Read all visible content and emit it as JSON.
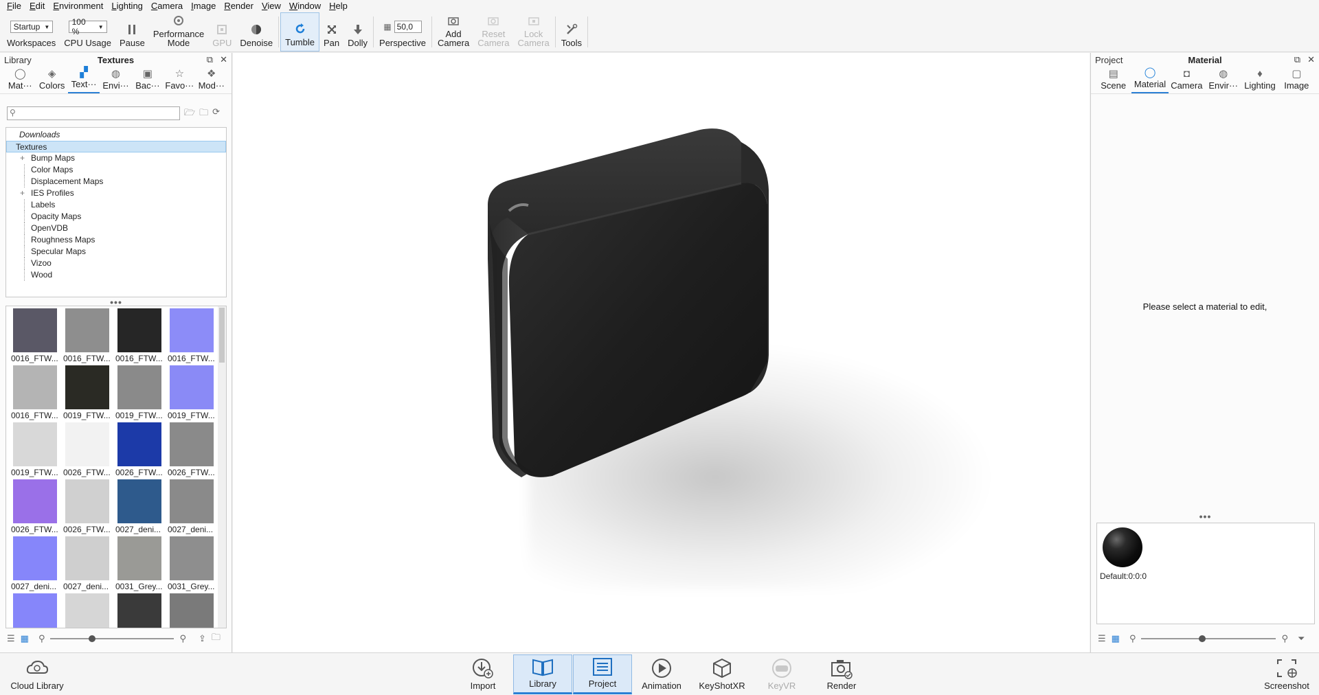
{
  "menu": [
    "File",
    "Edit",
    "Environment",
    "Lighting",
    "Camera",
    "Image",
    "Render",
    "View",
    "Window",
    "Help"
  ],
  "toolbar": {
    "workspace_value": "Startup",
    "workspaces_label": "Workspaces",
    "cpu_value": "100 %",
    "cpu_label": "CPU Usage",
    "pause_label": "Pause",
    "performance_label_1": "Performance",
    "performance_label_2": "Mode",
    "gpu_label": "GPU",
    "denoise_label": "Denoise",
    "tumble_label": "Tumble",
    "pan_label": "Pan",
    "dolly_label": "Dolly",
    "perspective_value": "50,0",
    "perspective_label": "Perspective",
    "add_camera_1": "Add",
    "add_camera_2": "Camera",
    "reset_camera_1": "Reset",
    "reset_camera_2": "Camera",
    "lock_camera_1": "Lock",
    "lock_camera_2": "Camera",
    "tools_label": "Tools"
  },
  "library": {
    "section": "Library",
    "title": "Textures",
    "tabs": [
      {
        "label": "Mat···",
        "icon": "material-icon"
      },
      {
        "label": "Colors",
        "icon": "colors-icon"
      },
      {
        "label": "Text···",
        "icon": "textures-icon",
        "selected": true
      },
      {
        "label": "Envi···",
        "icon": "environment-icon"
      },
      {
        "label": "Bac···",
        "icon": "backplates-icon"
      },
      {
        "label": "Favo···",
        "icon": "favorites-icon"
      },
      {
        "label": "Mod···",
        "icon": "models-icon"
      }
    ],
    "search_placeholder": "",
    "tree": {
      "downloads": "Downloads",
      "textures": "Textures",
      "children": [
        "Bump Maps",
        "Color Maps",
        "Displacement Maps",
        "IES Profiles",
        "Labels",
        "Opacity Maps",
        "OpenVDB",
        "Roughness Maps",
        "Specular Maps",
        "Vizoo",
        "Wood"
      ]
    },
    "thumbnails": [
      {
        "caption": "0016_FTW...",
        "color": "#5a5866"
      },
      {
        "caption": "0016_FTW...",
        "color": "#8e8e8e"
      },
      {
        "caption": "0016_FTW...",
        "color": "#262626"
      },
      {
        "caption": "0016_FTW...",
        "color": "#8c8cf8"
      },
      {
        "caption": "0016_FTW...",
        "color": "#b4b4b4"
      },
      {
        "caption": "0019_FTW...",
        "color": "#2a2a24"
      },
      {
        "caption": "0019_FTW...",
        "color": "#8a8a8a"
      },
      {
        "caption": "0019_FTW...",
        "color": "#8a8af6"
      },
      {
        "caption": "0019_FTW...",
        "color": "#d8d8d8"
      },
      {
        "caption": "0026_FTW...",
        "color": "#f2f2f2"
      },
      {
        "caption": "0026_FTW...",
        "color": "#1c3aa8"
      },
      {
        "caption": "0026_FTW...",
        "color": "#8a8a8a"
      },
      {
        "caption": "0026_FTW...",
        "color": "#9a70e8"
      },
      {
        "caption": "0026_FTW...",
        "color": "#d0d0d0"
      },
      {
        "caption": "0027_deni...",
        "color": "#2e5a8c"
      },
      {
        "caption": "0027_deni...",
        "color": "#8a8a8a"
      },
      {
        "caption": "0027_deni...",
        "color": "#8686fa"
      },
      {
        "caption": "0027_deni...",
        "color": "#cfcfcf"
      },
      {
        "caption": "0031_Grey...",
        "color": "#9a9a96"
      },
      {
        "caption": "0031_Grey...",
        "color": "#8e8e8e"
      },
      {
        "caption": "",
        "color": "#8686fa"
      },
      {
        "caption": "",
        "color": "#d6d6d6"
      },
      {
        "caption": "",
        "color": "#3a3a3a"
      },
      {
        "caption": "",
        "color": "#7a7a7a"
      }
    ]
  },
  "project": {
    "section": "Project",
    "title": "Material",
    "tabs": [
      {
        "label": "Scene",
        "icon": "scene-icon"
      },
      {
        "label": "Material",
        "icon": "material-icon",
        "selected": true
      },
      {
        "label": "Camera",
        "icon": "camera-icon"
      },
      {
        "label": "Envir···",
        "icon": "environment-icon"
      },
      {
        "label": "Lighting",
        "icon": "lighting-icon"
      },
      {
        "label": "Image",
        "icon": "image-icon"
      }
    ],
    "hint": "Please select a material to edit,",
    "material_name": "Default:0:0:0"
  },
  "bottombar": {
    "cloud_library": "Cloud Library",
    "import": "Import",
    "library": "Library",
    "project": "Project",
    "animation": "Animation",
    "keyshotxr": "KeyShotXR",
    "keyvr": "KeyVR",
    "render": "Render",
    "screenshot": "Screenshot"
  },
  "colors": {
    "accent": "#2a7fd4",
    "selection": "#cce4f7",
    "object": "#1a1a1a"
  }
}
